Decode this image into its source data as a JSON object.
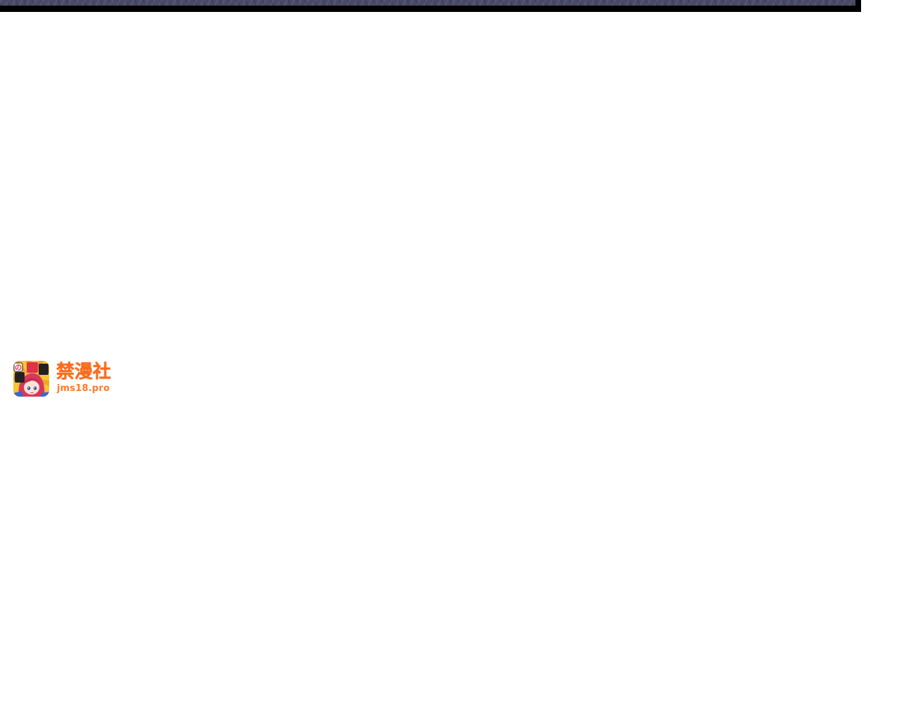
{
  "watermark": {
    "brand_name": "禁漫社",
    "url": "jms18.pro"
  },
  "colors": {
    "brand_orange": "#ff6a1a",
    "panel_border": "#000000",
    "panel_art": "#4a4a66",
    "background": "#ffffff"
  }
}
